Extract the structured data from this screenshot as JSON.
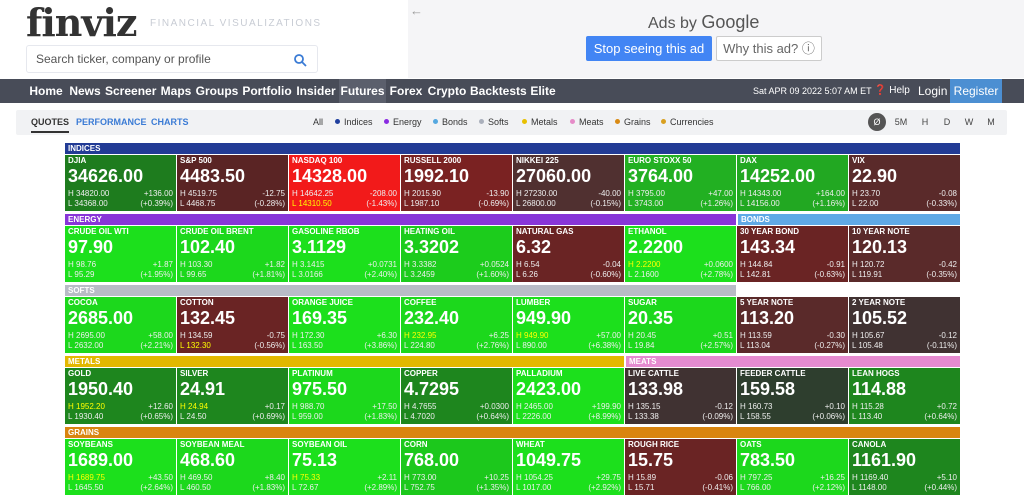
{
  "header": {
    "logo": "finviz",
    "tagline": "FINANCIAL VISUALIZATIONS",
    "search_placeholder": "Search ticker, company or profile"
  },
  "ad": {
    "back_arrow": "←",
    "ads_by": "Ads by",
    "google": "Google",
    "stop": "Stop seeing this ad",
    "why": "Why this ad? ⓘ"
  },
  "nav": {
    "items": [
      "Home",
      "News",
      "Screener",
      "Maps",
      "Groups",
      "Portfolio",
      "Insider",
      "Futures",
      "Forex",
      "Crypto",
      "Backtests",
      "Elite"
    ],
    "active": "Futures",
    "date": "Sat APR 09 2022 5:07 AM ET",
    "help": "❓ Help",
    "login": "Login",
    "register": "Register"
  },
  "subnav": {
    "tabs": [
      "QUOTES",
      "PERFORMANCE",
      "CHARTS"
    ],
    "legend": [
      {
        "label": "All",
        "color": ""
      },
      {
        "label": "Indices",
        "color": "#1f3f9e"
      },
      {
        "label": "Energy",
        "color": "#8a2be2"
      },
      {
        "label": "Bonds",
        "color": "#55a8e0"
      },
      {
        "label": "Softs",
        "color": "#aab0bc"
      },
      {
        "label": "Metals",
        "color": "#e8c000"
      },
      {
        "label": "Meats",
        "color": "#e58bc8"
      },
      {
        "label": "Grains",
        "color": "#d98a14"
      },
      {
        "label": "Currencies",
        "color": "#d9a020"
      }
    ],
    "timeframes": [
      "Ø",
      "5M",
      "H",
      "D",
      "W",
      "M"
    ]
  },
  "colors": {
    "indices": "#223b95",
    "energy": "#8835d8",
    "bonds": "#5fa9e6",
    "softs": "#b8bcc6",
    "metals": "#e3b800",
    "meats": "#e58bd0",
    "grains": "#d98510"
  },
  "sections": [
    "INDICES",
    "ENERGY",
    "BONDS",
    "SOFTS",
    "METALS",
    "MEATS",
    "GRAINS"
  ],
  "tiles": [
    {
      "name": "DJIA",
      "price": "34626.00",
      "h": "H 34820.00",
      "l": "L 34368.00",
      "chg": "+136.00",
      "pct": "(+0.39%)",
      "color": "#1e7c1e"
    },
    {
      "name": "S&P 500",
      "price": "4483.50",
      "h": "H 4519.75",
      "l": "L 4468.75",
      "chg": "-12.75",
      "pct": "(-0.28%)",
      "color": "#5a2424"
    },
    {
      "name": "NASDAQ 100",
      "price": "14328.00",
      "h": "H 14642.25",
      "l": "L 14310.50",
      "chg": "-208.00",
      "pct": "(-1.43%)",
      "color": "#f21a1a",
      "lowyellow": true
    },
    {
      "name": "RUSSELL 2000",
      "price": "1992.10",
      "h": "H 2015.90",
      "l": "L 1987.10",
      "chg": "-13.90",
      "pct": "(-0.69%)",
      "color": "#7a2222"
    },
    {
      "name": "NIKKEI 225",
      "price": "27060.00",
      "h": "H 27230.00",
      "l": "L 26800.00",
      "chg": "-40.00",
      "pct": "(-0.15%)",
      "color": "#503030"
    },
    {
      "name": "EURO STOXX 50",
      "price": "3764.00",
      "h": "H 3795.00",
      "l": "L 3743.00",
      "chg": "+47.00",
      "pct": "(+1.26%)",
      "color": "#22b022"
    },
    {
      "name": "DAX",
      "price": "14252.00",
      "h": "H 14343.00",
      "l": "L 14156.00",
      "chg": "+164.00",
      "pct": "(+1.16%)",
      "color": "#22a822"
    },
    {
      "name": "VIX",
      "price": "22.90",
      "h": "H 23.70",
      "l": "L 22.00",
      "chg": "-0.08",
      "pct": "(-0.33%)",
      "color": "#5a2a2a"
    },
    {
      "name": "CRUDE OIL WTI",
      "price": "97.90",
      "h": "H 98.76",
      "l": "L 95.29",
      "chg": "+1.87",
      "pct": "(+1.95%)",
      "color": "#1ce01c"
    },
    {
      "name": "CRUDE OIL BRENT",
      "price": "102.40",
      "h": "H 103.30",
      "l": "L 99.65",
      "chg": "+1.82",
      "pct": "(+1.81%)",
      "color": "#1cd81c"
    },
    {
      "name": "GASOLINE RBOB",
      "price": "3.1129",
      "h": "H 3.1415",
      "l": "L 3.0166",
      "chg": "+0.0731",
      "pct": "(+2.40%)",
      "color": "#1ce01c"
    },
    {
      "name": "HEATING OIL",
      "price": "3.3202",
      "h": "H 3.3382",
      "l": "L 3.2459",
      "chg": "+0.0524",
      "pct": "(+1.60%)",
      "color": "#1ccc1c"
    },
    {
      "name": "NATURAL GAS",
      "price": "6.32",
      "h": "H 6.54",
      "l": "L 6.26",
      "chg": "-0.04",
      "pct": "(-0.60%)",
      "color": "#6a2424"
    },
    {
      "name": "ETHANOL",
      "price": "2.2200",
      "h": "H 2.2200",
      "l": "L 2.1600",
      "chg": "+0.0600",
      "pct": "(+2.78%)",
      "color": "#1ce01c",
      "highyellow": true
    },
    {
      "name": "30 YEAR BOND",
      "price": "143.34",
      "h": "H 144.84",
      "l": "L 142.81",
      "chg": "-0.91",
      "pct": "(-0.63%)",
      "color": "#6a2424"
    },
    {
      "name": "10 YEAR NOTE",
      "price": "120.13",
      "h": "H 120.72",
      "l": "L 119.91",
      "chg": "-0.42",
      "pct": "(-0.35%)",
      "color": "#5a2a2a"
    },
    {
      "name": "COCOA",
      "price": "2685.00",
      "h": "H 2695.00",
      "l": "L 2632.00",
      "chg": "+58.00",
      "pct": "(+2.21%)",
      "color": "#1cd81c"
    },
    {
      "name": "COTTON",
      "price": "132.45",
      "h": "H 134.59",
      "l": "L 132.30",
      "chg": "-0.75",
      "pct": "(-0.56%)",
      "color": "#6a2424",
      "lowyellow": true
    },
    {
      "name": "ORANGE JUICE",
      "price": "169.35",
      "h": "H 172.30",
      "l": "L 163.50",
      "chg": "+6.30",
      "pct": "(+3.86%)",
      "color": "#1ce01c"
    },
    {
      "name": "COFFEE",
      "price": "232.40",
      "h": "H 232.95",
      "l": "L 224.80",
      "chg": "+6.25",
      "pct": "(+2.76%)",
      "color": "#1cd81c",
      "highyellow": true
    },
    {
      "name": "LUMBER",
      "price": "949.90",
      "h": "H 949.90",
      "l": "L 890.00",
      "chg": "+57.00",
      "pct": "(+6.38%)",
      "color": "#1ce01c",
      "highyellow": true
    },
    {
      "name": "SUGAR",
      "price": "20.35",
      "h": "H 20.45",
      "l": "L 19.84",
      "chg": "+0.51",
      "pct": "(+2.57%)",
      "color": "#1cd81c"
    },
    {
      "name": "5 YEAR NOTE",
      "price": "113.20",
      "h": "H 113.59",
      "l": "L 113.04",
      "chg": "-0.30",
      "pct": "(-0.27%)",
      "color": "#5a2a2a"
    },
    {
      "name": "2 YEAR NOTE",
      "price": "105.52",
      "h": "H 105.67",
      "l": "L 105.48",
      "chg": "-0.12",
      "pct": "(-0.11%)",
      "color": "#403232"
    },
    {
      "name": "GOLD",
      "price": "1950.40",
      "h": "H 1952.20",
      "l": "L 1930.40",
      "chg": "+12.60",
      "pct": "(+0.65%)",
      "color": "#1e861e",
      "highyellow": true
    },
    {
      "name": "SILVER",
      "price": "24.91",
      "h": "H 24.94",
      "l": "L 24.50",
      "chg": "+0.17",
      "pct": "(+0.69%)",
      "color": "#1e861e",
      "highyellow": true
    },
    {
      "name": "PLATINUM",
      "price": "975.50",
      "h": "H 988.70",
      "l": "L 959.00",
      "chg": "+17.50",
      "pct": "(+1.83%)",
      "color": "#1cd81c"
    },
    {
      "name": "COPPER",
      "price": "4.7295",
      "h": "H 4.7655",
      "l": "L 4.7020",
      "chg": "+0.0300",
      "pct": "(+0.64%)",
      "color": "#1e861e"
    },
    {
      "name": "PALLADIUM",
      "price": "2423.00",
      "h": "H 2465.00",
      "l": "L 2226.00",
      "chg": "+199.90",
      "pct": "(+8.99%)",
      "color": "#1ce01c"
    },
    {
      "name": "LIVE CATTLE",
      "price": "133.98",
      "h": "H 135.15",
      "l": "L 133.38",
      "chg": "-0.12",
      "pct": "(-0.09%)",
      "color": "#403232"
    },
    {
      "name": "FEEDER CATTLE",
      "price": "159.58",
      "h": "H 160.73",
      "l": "L 158.55",
      "chg": "+0.10",
      "pct": "(+0.06%)",
      "color": "#2e3e2e"
    },
    {
      "name": "LEAN HOGS",
      "price": "114.88",
      "h": "H 115.28",
      "l": "L 113.40",
      "chg": "+0.72",
      "pct": "(+0.64%)",
      "color": "#1e861e"
    },
    {
      "name": "SOYBEANS",
      "price": "1689.00",
      "h": "H 1689.75",
      "l": "L 1645.50",
      "chg": "+43.50",
      "pct": "(+2.64%)",
      "color": "#1ce01c",
      "highyellow": true
    },
    {
      "name": "SOYBEAN MEAL",
      "price": "468.60",
      "h": "H 469.50",
      "l": "L 460.50",
      "chg": "+8.40",
      "pct": "(+1.83%)",
      "color": "#1cd81c"
    },
    {
      "name": "SOYBEAN OIL",
      "price": "75.13",
      "h": "H 75.33",
      "l": "L 72.67",
      "chg": "+2.11",
      "pct": "(+2.89%)",
      "color": "#1ce01c",
      "highyellow": true
    },
    {
      "name": "CORN",
      "price": "768.00",
      "h": "H 773.00",
      "l": "L 752.75",
      "chg": "+10.25",
      "pct": "(+1.35%)",
      "color": "#1cc81c"
    },
    {
      "name": "WHEAT",
      "price": "1049.75",
      "h": "H 1054.25",
      "l": "L 1017.00",
      "chg": "+29.75",
      "pct": "(+2.92%)",
      "color": "#1ce01c"
    },
    {
      "name": "ROUGH RICE",
      "price": "15.75",
      "h": "H 15.89",
      "l": "L 15.71",
      "chg": "-0.06",
      "pct": "(-0.41%)",
      "color": "#6a2424"
    },
    {
      "name": "OATS",
      "price": "783.50",
      "h": "H 797.25",
      "l": "L 766.00",
      "chg": "+16.25",
      "pct": "(+2.12%)",
      "color": "#1cd81c"
    },
    {
      "name": "CANOLA",
      "price": "1161.90",
      "h": "H 1169.40",
      "l": "L 1148.00",
      "chg": "+5.10",
      "pct": "(+0.44%)",
      "color": "#1e861e"
    }
  ]
}
